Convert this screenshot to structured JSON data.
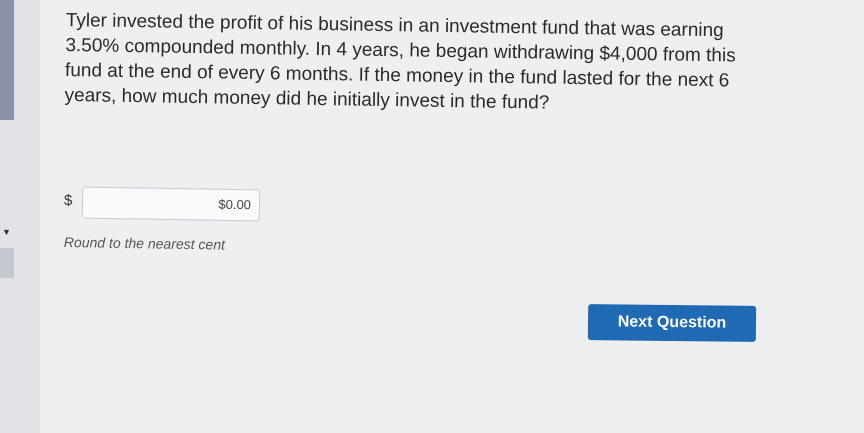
{
  "question": {
    "text": "Tyler invested the profit of his business in an investment fund that was earning 3.50% compounded monthly. In 4 years, he began withdrawing $4,000 from this fund at the end of every 6 months. If the money in the fund lasted for the next 6 years, how much money did he initially invest in the fund?"
  },
  "answer": {
    "currency_symbol": "$",
    "value": "$0.00",
    "hint": "Round to the nearest cent"
  },
  "actions": {
    "next_label": "Next Question"
  },
  "colors": {
    "accent": "#1f6ab3",
    "background": "#eeeff1"
  }
}
